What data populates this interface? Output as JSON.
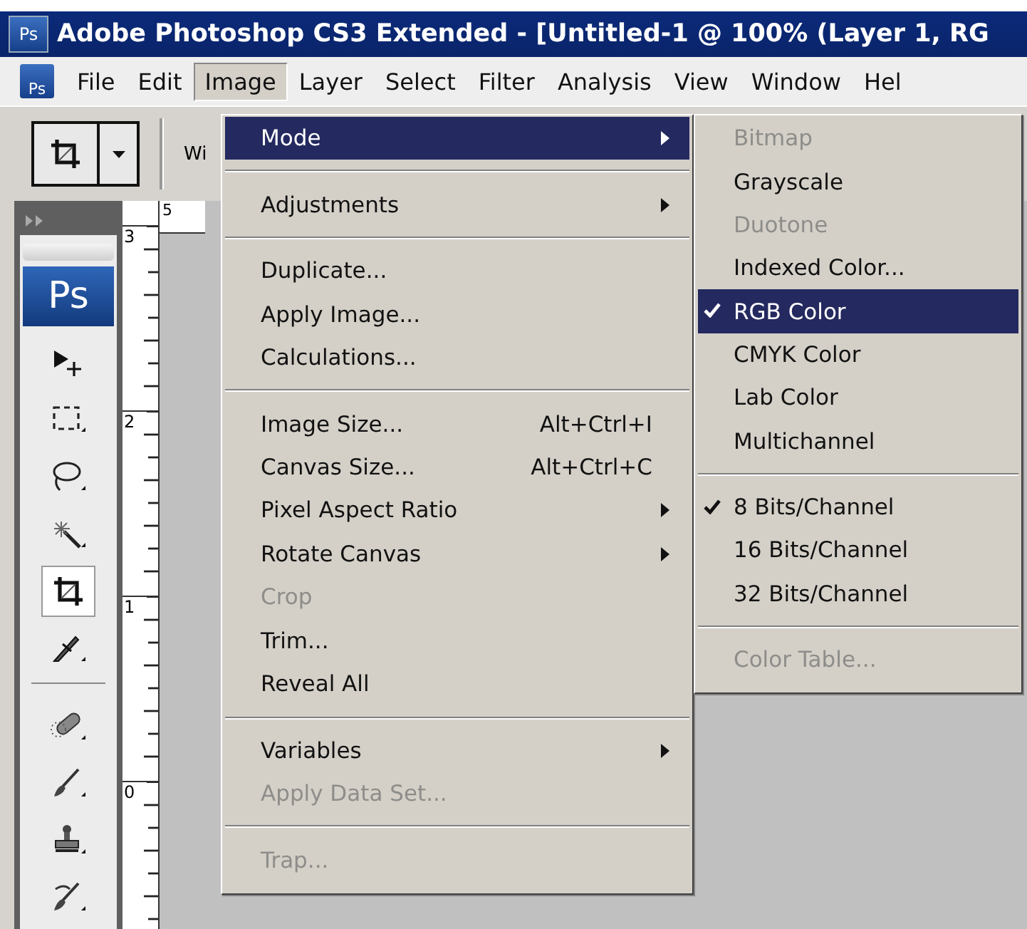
{
  "window": {
    "icon_text": "Ps",
    "title": "Adobe Photoshop CS3 Extended - [Untitled-1 @ 100% (Layer 1, RG"
  },
  "menu_bar_icon_text": "Ps",
  "menu_bar": [
    {
      "label": "File",
      "selected": false
    },
    {
      "label": "Edit",
      "selected": false
    },
    {
      "label": "Image",
      "selected": true
    },
    {
      "label": "Layer",
      "selected": false
    },
    {
      "label": "Select",
      "selected": false
    },
    {
      "label": "Filter",
      "selected": false
    },
    {
      "label": "Analysis",
      "selected": false
    },
    {
      "label": "View",
      "selected": false
    },
    {
      "label": "Window",
      "selected": false
    },
    {
      "label": "Hel",
      "selected": false
    }
  ],
  "options_bar": {
    "field_label": "Wi"
  },
  "toolbox": {
    "logo": "Ps",
    "groups": [
      {
        "tools": [
          {
            "kind": "move",
            "selected": false
          },
          {
            "kind": "marquee",
            "selected": false
          },
          {
            "kind": "lasso",
            "selected": false
          },
          {
            "kind": "wand",
            "selected": false
          },
          {
            "kind": "crop",
            "selected": true
          },
          {
            "kind": "slice",
            "selected": false
          }
        ]
      },
      {
        "tools": [
          {
            "kind": "heal",
            "selected": false
          },
          {
            "kind": "brush",
            "selected": false
          },
          {
            "kind": "stamp",
            "selected": false
          },
          {
            "kind": "history",
            "selected": false
          }
        ]
      }
    ]
  },
  "rulers": {
    "horizontal": [
      "5"
    ],
    "vertical": [
      "3",
      "2",
      "1",
      "0"
    ]
  },
  "image_menu": {
    "items": [
      {
        "kind": "item",
        "label": "Mode",
        "submenu": true,
        "disabled": false,
        "selected": true
      },
      {
        "kind": "separator"
      },
      {
        "kind": "item",
        "label": "Adjustments",
        "submenu": true,
        "disabled": false,
        "selected": false
      },
      {
        "kind": "separator"
      },
      {
        "kind": "item",
        "label": "Duplicate...",
        "submenu": false,
        "disabled": false,
        "selected": false
      },
      {
        "kind": "item",
        "label": "Apply Image...",
        "submenu": false,
        "disabled": false,
        "selected": false
      },
      {
        "kind": "item",
        "label": "Calculations...",
        "submenu": false,
        "disabled": false,
        "selected": false
      },
      {
        "kind": "separator"
      },
      {
        "kind": "item",
        "label": "Image Size...",
        "shortcut": "Alt+Ctrl+I",
        "submenu": false,
        "disabled": false,
        "selected": false
      },
      {
        "kind": "item",
        "label": "Canvas Size...",
        "shortcut": "Alt+Ctrl+C",
        "submenu": false,
        "disabled": false,
        "selected": false
      },
      {
        "kind": "item",
        "label": "Pixel Aspect Ratio",
        "submenu": true,
        "disabled": false,
        "selected": false
      },
      {
        "kind": "item",
        "label": "Rotate Canvas",
        "submenu": true,
        "disabled": false,
        "selected": false
      },
      {
        "kind": "item",
        "label": "Crop",
        "submenu": false,
        "disabled": true,
        "selected": false
      },
      {
        "kind": "item",
        "label": "Trim...",
        "submenu": false,
        "disabled": false,
        "selected": false
      },
      {
        "kind": "item",
        "label": "Reveal All",
        "submenu": false,
        "disabled": false,
        "selected": false
      },
      {
        "kind": "separator"
      },
      {
        "kind": "item",
        "label": "Variables",
        "submenu": true,
        "disabled": false,
        "selected": false
      },
      {
        "kind": "item",
        "label": "Apply Data Set...",
        "submenu": false,
        "disabled": true,
        "selected": false
      },
      {
        "kind": "separator"
      },
      {
        "kind": "item",
        "label": "Trap...",
        "submenu": false,
        "disabled": true,
        "selected": false
      }
    ]
  },
  "mode_submenu": {
    "items": [
      {
        "kind": "item",
        "label": "Bitmap",
        "checked": false,
        "disabled": true,
        "selected": false
      },
      {
        "kind": "item",
        "label": "Grayscale",
        "checked": false,
        "disabled": false,
        "selected": false
      },
      {
        "kind": "item",
        "label": "Duotone",
        "checked": false,
        "disabled": true,
        "selected": false
      },
      {
        "kind": "item",
        "label": "Indexed Color...",
        "checked": false,
        "disabled": false,
        "selected": false
      },
      {
        "kind": "item",
        "label": "RGB Color",
        "checked": true,
        "disabled": false,
        "selected": true
      },
      {
        "kind": "item",
        "label": "CMYK Color",
        "checked": false,
        "disabled": false,
        "selected": false
      },
      {
        "kind": "item",
        "label": "Lab Color",
        "checked": false,
        "disabled": false,
        "selected": false
      },
      {
        "kind": "item",
        "label": "Multichannel",
        "checked": false,
        "disabled": false,
        "selected": false
      },
      {
        "kind": "separator"
      },
      {
        "kind": "item",
        "label": "8 Bits/Channel",
        "checked": true,
        "disabled": false,
        "selected": false
      },
      {
        "kind": "item",
        "label": "16 Bits/Channel",
        "checked": false,
        "disabled": false,
        "selected": false
      },
      {
        "kind": "item",
        "label": "32 Bits/Channel",
        "checked": false,
        "disabled": false,
        "selected": false
      },
      {
        "kind": "separator"
      },
      {
        "kind": "item",
        "label": "Color Table...",
        "checked": false,
        "disabled": true,
        "selected": false
      }
    ]
  }
}
